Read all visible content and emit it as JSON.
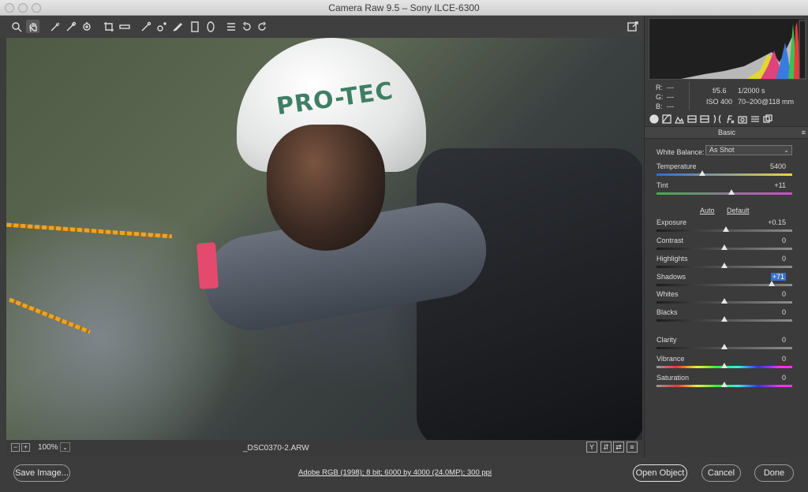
{
  "window": {
    "title": "Camera Raw 9.5  –  Sony ILCE-6300"
  },
  "toolbar": {
    "tools": [
      "zoom-icon",
      "hand-icon",
      "white-balance-icon",
      "color-sampler-icon",
      "targeted-adjustment-icon",
      "crop-icon",
      "straighten-icon",
      "spot-removal-icon",
      "red-eye-icon",
      "adjustment-brush-icon",
      "graduated-filter-icon",
      "radial-filter-icon",
      "preferences-icon",
      "rotate-ccw-icon",
      "rotate-cw-icon"
    ],
    "fullscreen_icon": "toggle-fullscreen-icon"
  },
  "preview": {
    "zoom_label": "100%",
    "zoom_minus": "−",
    "zoom_plus": "+",
    "filename": "_DSC0370-2.ARW",
    "before_after_labels": [
      "Y",
      "⇵",
      "⇄",
      "≡"
    ]
  },
  "histogram": {
    "rgb_labels": [
      "R:",
      "G:",
      "B:"
    ],
    "rgb_values": [
      "---",
      "---",
      "---"
    ],
    "aperture": "f/5.6",
    "shutter": "1/2000 s",
    "iso": "ISO 400",
    "lens": "70–200@118 mm"
  },
  "panel": {
    "section_title": "Basic",
    "white_balance_label": "White Balance:",
    "white_balance_value": "As Shot",
    "auto_label": "Auto",
    "default_label": "Default",
    "sliders": [
      {
        "name": "Temperature",
        "value": "5400",
        "position": 0.34
      },
      {
        "name": "Tint",
        "value": "+11",
        "position": 0.55
      },
      {
        "name": "Exposure",
        "value": "+0.15",
        "position": 0.51
      },
      {
        "name": "Contrast",
        "value": "0",
        "position": 0.5
      },
      {
        "name": "Highlights",
        "value": "0",
        "position": 0.5
      },
      {
        "name": "Shadows",
        "value": "+71",
        "position": 0.85
      },
      {
        "name": "Whites",
        "value": "0",
        "position": 0.5
      },
      {
        "name": "Blacks",
        "value": "0",
        "position": 0.5
      },
      {
        "name": "Clarity",
        "value": "0",
        "position": 0.5
      },
      {
        "name": "Vibrance",
        "value": "0",
        "position": 0.5
      },
      {
        "name": "Saturation",
        "value": "0",
        "position": 0.5
      }
    ]
  },
  "bottom": {
    "save_label": "Save Image...",
    "workflow_label": "Adobe RGB (1998); 8 bit; 6000 by 4000 (24.0MP); 300 ppi",
    "open_label": "Open Object",
    "cancel_label": "Cancel",
    "done_label": "Done"
  }
}
